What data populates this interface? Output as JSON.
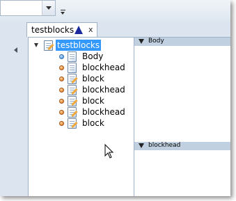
{
  "document_tab": {
    "title": "testblocks",
    "close_glyph": "x",
    "modified_indicator": "blue-triangle-icon"
  },
  "tree": {
    "root": {
      "label": "testblocks",
      "icon": "document-pencil-icon",
      "selected": true
    },
    "children": [
      {
        "label": "Body",
        "bullet": "blue",
        "icon": "document-icon"
      },
      {
        "label": "blockhead",
        "bullet": "orange",
        "icon": "document-icon"
      },
      {
        "label": "block",
        "bullet": "orange",
        "icon": "document-pencil-icon"
      },
      {
        "label": "blockhead",
        "bullet": "orange",
        "icon": "document-pencil-icon"
      },
      {
        "label": "block",
        "bullet": "orange",
        "icon": "document-pencil-icon"
      },
      {
        "label": "blockhead",
        "bullet": "orange",
        "icon": "document-pencil-icon"
      },
      {
        "label": "block",
        "bullet": "orange",
        "icon": "document-pencil-icon"
      }
    ]
  },
  "panels": [
    {
      "label": "Body"
    },
    {
      "label": "blockhead"
    }
  ],
  "colors": {
    "selection": "#3399ff",
    "section_header": "#c1d0e0",
    "chrome": "#dbe4ef",
    "tab_indicator": "#1b2a9e"
  }
}
